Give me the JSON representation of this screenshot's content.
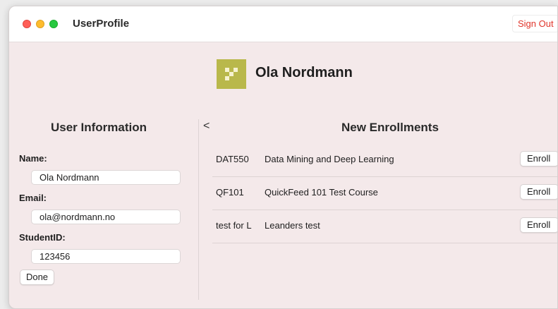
{
  "window": {
    "title": "UserProfile"
  },
  "header": {
    "sign_out_label": "Sign Out"
  },
  "profile": {
    "name": "Ola Nordmann"
  },
  "user_info": {
    "title": "User Information",
    "name_label": "Name:",
    "name_value": "Ola Nordmann",
    "email_label": "Email:",
    "email_value": "ola@nordmann.no",
    "student_id_label": "StudentID:",
    "student_id_value": "123456",
    "done_label": "Done"
  },
  "enrollments": {
    "collapse_glyph": "<",
    "title": "New Enrollments",
    "courses": [
      {
        "code": "DAT550",
        "name": "Data Mining and Deep Learning",
        "button": "Enroll"
      },
      {
        "code": "QF101",
        "name": "QuickFeed 101 Test Course",
        "button": "Enroll"
      },
      {
        "code": "test for L",
        "name": "Leanders test",
        "button": "Enroll"
      }
    ]
  },
  "colors": {
    "background": "#f4e9ea",
    "avatar": "#b9b84b",
    "sign_out_text": "#e0342a"
  },
  "icons": {
    "avatar": "identicon-avatar",
    "collapse": "chevron-left-icon"
  }
}
